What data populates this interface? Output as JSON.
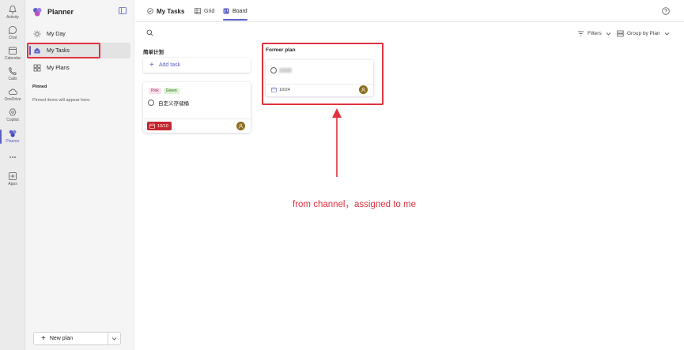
{
  "rail": {
    "items": [
      {
        "label": "Activity",
        "icon": "bell-icon"
      },
      {
        "label": "Chat",
        "icon": "chat-icon"
      },
      {
        "label": "Calendar",
        "icon": "calendar-icon"
      },
      {
        "label": "Calls",
        "icon": "phone-icon"
      },
      {
        "label": "OneDrive",
        "icon": "cloud-icon"
      },
      {
        "label": "Copilot",
        "icon": "copilot-icon"
      },
      {
        "label": "Planner",
        "icon": "planner-icon"
      },
      {
        "label": "",
        "icon": "more-icon"
      },
      {
        "label": "Apps",
        "icon": "apps-icon"
      }
    ]
  },
  "sidebar": {
    "title": "Planner",
    "nav": [
      {
        "label": "My Day",
        "icon": "sun-icon"
      },
      {
        "label": "My Tasks",
        "icon": "home-icon"
      },
      {
        "label": "My Plans",
        "icon": "grid-icon"
      }
    ],
    "pinned_heading": "Pinned",
    "pinned_empty": "Pinned items will appear here.",
    "new_plan": "New plan"
  },
  "header": {
    "title": "My Tasks",
    "tabs": [
      {
        "label": "Grid",
        "icon": "table-icon"
      },
      {
        "label": "Board",
        "icon": "board-icon"
      }
    ]
  },
  "toolbar": {
    "filters": "Filters",
    "group_by": "Group by Plan"
  },
  "board": {
    "columns": [
      {
        "title": "简单计划",
        "add_task": "Add task",
        "cards": [
          {
            "labels": [
              "Pink",
              "Green"
            ],
            "title": "自定义存储桶",
            "due": "10/10",
            "overdue": true
          }
        ]
      },
      {
        "title": "Former plan",
        "cards": [
          {
            "title": "",
            "due": "10/24",
            "overdue": false
          }
        ]
      }
    ]
  },
  "annotation": {
    "text": "from channel，assigned to me",
    "color": "#e0323e"
  },
  "colors": {
    "accent": "#5b5fc7",
    "overdue": "#c4262e",
    "avatar": "#8b6d1c"
  }
}
